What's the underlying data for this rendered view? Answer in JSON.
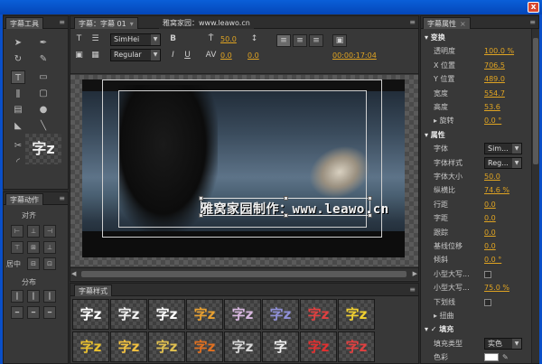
{
  "window": {
    "close_glyph": "x"
  },
  "tools_panel": {
    "tab": "字幕工具",
    "sample": "字z"
  },
  "actions_panel": {
    "tab": "字幕动作",
    "align_label": "对齐",
    "center_label": "居中",
    "distribute_label": "分布"
  },
  "main_panel": {
    "tab": "字幕：字幕 01",
    "tab_menu": "▾",
    "tab2": "雅窝家园：www.leawo.cn",
    "font_family": "SimHei",
    "font_style": "Regular",
    "font_size": "50.0",
    "kerning": "0.0",
    "leading": "0.0",
    "timecode": "00:00:17:04",
    "title_text": "雅窝家园制作：www.leawo.cn",
    "bold_glyph": "B",
    "italic_glyph": "I",
    "underline_glyph": "U"
  },
  "styles_panel": {
    "tab": "字幕样式",
    "swatches": [
      {
        "text": "字z",
        "color": "#ffffff"
      },
      {
        "text": "字z",
        "color": "#f0f0f0"
      },
      {
        "text": "字z",
        "color": "#ffffff"
      },
      {
        "text": "字z",
        "color": "#e8a030"
      },
      {
        "text": "字z",
        "color": "#d8b8e0"
      },
      {
        "text": "字z",
        "color": "#9090d8"
      },
      {
        "text": "字z",
        "color": "#e04040"
      },
      {
        "text": "字z",
        "color": "#f0d030"
      },
      {
        "text": "字z",
        "color": "#e8c030"
      },
      {
        "text": "字z",
        "color": "#f0c040"
      },
      {
        "text": "字z",
        "color": "#e0c050"
      },
      {
        "text": "字z",
        "color": "#e07020"
      },
      {
        "text": "字z",
        "color": "#d8d8d8"
      },
      {
        "text": "字",
        "color": "#f0f0f0"
      },
      {
        "text": "字z",
        "color": "#e03030"
      },
      {
        "text": "字z",
        "color": "#e04040"
      }
    ]
  },
  "props_panel": {
    "tab": "字幕属性",
    "rows": [
      {
        "type": "section",
        "label": "▾ 变换"
      },
      {
        "type": "value",
        "label": "透明度",
        "value": "100.0 %"
      },
      {
        "type": "value",
        "label": "X 位置",
        "value": "706.5"
      },
      {
        "type": "value",
        "label": "Y 位置",
        "value": "489.0"
      },
      {
        "type": "value",
        "label": "宽度",
        "value": "554.7"
      },
      {
        "type": "value",
        "label": "高度",
        "value": "53.6"
      },
      {
        "type": "value",
        "label": "▸ 旋转",
        "value": "0.0 °"
      },
      {
        "type": "section",
        "label": "▾ 属性"
      },
      {
        "type": "select",
        "label": "字体",
        "value": "Sim..."
      },
      {
        "type": "select",
        "label": "字体样式",
        "value": "Reg..."
      },
      {
        "type": "value",
        "label": "字体大小",
        "value": "50.0"
      },
      {
        "type": "value",
        "label": "纵横比",
        "value": "74.6 %"
      },
      {
        "type": "value",
        "label": "行距",
        "value": "0.0"
      },
      {
        "type": "value",
        "label": "字距",
        "value": "0.0"
      },
      {
        "type": "value",
        "label": "跟踪",
        "value": "0.0"
      },
      {
        "type": "value",
        "label": "基线位移",
        "value": "0.0"
      },
      {
        "type": "value",
        "label": "倾斜",
        "value": "0.0 °"
      },
      {
        "type": "check",
        "label": "小型大写..."
      },
      {
        "type": "value",
        "label": "小型大写...",
        "value": "75.0 %"
      },
      {
        "type": "check",
        "label": "下划线"
      },
      {
        "type": "value",
        "label": "▸ 扭曲",
        "value": ""
      },
      {
        "type": "section",
        "label": "▾ ✓ 填充"
      },
      {
        "type": "select",
        "label": "填充类型",
        "value": "实色"
      },
      {
        "type": "color",
        "label": "色彩",
        "value": ""
      }
    ]
  }
}
